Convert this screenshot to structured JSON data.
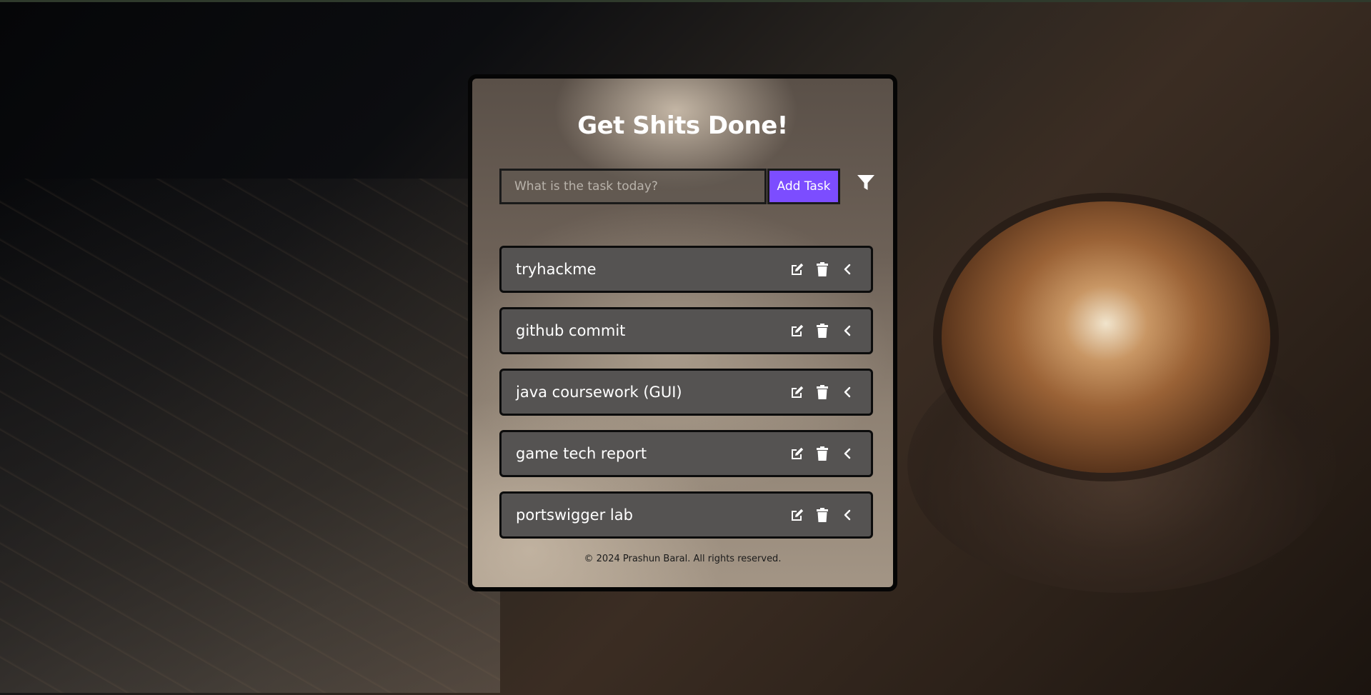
{
  "app": {
    "title": "Get Shits Done!"
  },
  "input": {
    "placeholder": "What is the task today?",
    "value": ""
  },
  "buttons": {
    "add_task_label": "Add Task",
    "filter_icon": "filter-icon"
  },
  "tasks": [
    {
      "label": "tryhackme"
    },
    {
      "label": "github commit"
    },
    {
      "label": "java coursework (GUI)"
    },
    {
      "label": "game tech report"
    },
    {
      "label": "portswigger lab"
    }
  ],
  "task_actions": {
    "edit_icon": "edit-icon",
    "delete_icon": "trash-icon",
    "expand_icon": "chevron-left-icon"
  },
  "footer": {
    "text": "© 2024 Prashun Baral. All rights reserved."
  },
  "colors": {
    "accent": "#7c4dff",
    "task_bg": "#555352",
    "border": "#0c0c0c"
  }
}
